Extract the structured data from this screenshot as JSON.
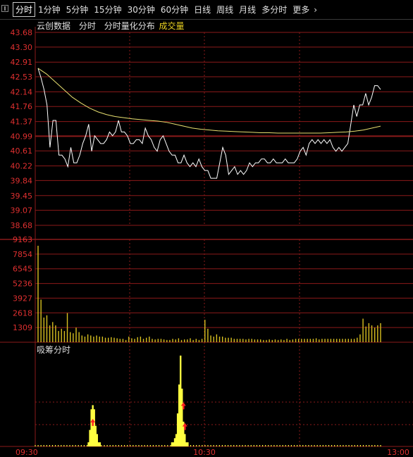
{
  "tabs": [
    {
      "label": "分时",
      "active": true
    },
    {
      "label": "1分钟"
    },
    {
      "label": "5分钟"
    },
    {
      "label": "15分钟"
    },
    {
      "label": "30分钟"
    },
    {
      "label": "60分钟"
    },
    {
      "label": "日线"
    },
    {
      "label": "周线"
    },
    {
      "label": "月线"
    },
    {
      "label": "多分时"
    },
    {
      "label": "更多"
    }
  ],
  "chart_labels": {
    "source": "云创数据",
    "mode": "分时",
    "distribution": "分时量化分布",
    "volume_label": "成交量",
    "chip_title": "吸筹分时"
  },
  "colors": {
    "background": "#000000",
    "grid": "#8b1a1a",
    "price_line": "#ffffff",
    "avg_line": "#e8e070",
    "volume_bar": "#d8c020",
    "axis_text": "#e03030",
    "chip_bar": "#ffff40",
    "chip_marker": "#ff2020"
  },
  "chart_data": [
    {
      "type": "line",
      "panel": "price",
      "yticks": [
        "43.68",
        "43.30",
        "42.91",
        "42.53",
        "42.14",
        "41.76",
        "41.37",
        "40.99",
        "40.61",
        "40.22",
        "39.84",
        "39.45",
        "39.07",
        "38.68"
      ],
      "ylim": [
        38.68,
        43.68
      ],
      "prev_close": 40.99,
      "xticks": [
        "09:30",
        "10:30",
        "13:00"
      ],
      "series": [
        {
          "values": [
            42.75,
            42.5,
            42.2,
            41.8,
            40.7,
            41.4,
            41.4,
            40.5,
            40.5,
            40.4,
            40.2,
            40.7,
            40.3,
            40.3,
            40.5,
            40.8,
            41.0,
            41.3,
            40.6,
            41.0,
            40.9,
            40.8,
            40.8,
            40.9,
            41.1,
            41.0,
            41.1,
            41.4,
            41.1,
            41.1,
            41.0,
            40.8,
            40.8,
            40.9,
            40.9,
            40.8,
            41.2,
            41.0,
            40.9,
            40.7,
            40.6,
            40.9,
            41.0,
            40.8,
            40.6,
            40.5,
            40.5,
            40.3,
            40.3,
            40.5,
            40.3,
            40.2,
            40.3,
            40.2,
            40.4,
            40.2,
            40.1,
            40.1,
            39.9,
            39.9,
            39.9,
            40.3,
            40.7,
            40.5,
            40.0,
            40.1,
            40.2,
            40.0,
            40.1,
            40.0,
            40.1,
            40.3,
            40.2,
            40.3,
            40.3,
            40.4,
            40.4,
            40.3,
            40.3,
            40.4,
            40.3,
            40.3,
            40.3,
            40.4,
            40.3,
            40.3,
            40.3,
            40.4,
            40.6,
            40.7,
            40.5,
            40.8,
            40.9,
            40.8,
            40.9,
            40.8,
            40.9,
            40.8,
            40.9,
            40.7,
            40.6,
            40.7,
            40.6,
            40.7,
            40.8,
            41.3,
            41.8,
            41.5,
            41.8,
            41.8,
            42.1,
            41.8,
            42.0,
            42.3,
            42.3,
            42.2
          ]
        },
        {
          "values": [
            42.75,
            42.6,
            42.4,
            42.2,
            42.0,
            41.85,
            41.72,
            41.62,
            41.55,
            41.5,
            41.47,
            41.44,
            41.42,
            41.4,
            41.38,
            41.35,
            41.3,
            41.25,
            41.2,
            41.17,
            41.15,
            41.13,
            41.12,
            41.11,
            41.1,
            41.09,
            41.08,
            41.08,
            41.07,
            41.07,
            41.07,
            41.07,
            41.07,
            41.07,
            41.08,
            41.09,
            41.1,
            41.12,
            41.15,
            41.2,
            41.25
          ]
        }
      ]
    },
    {
      "type": "bar",
      "panel": "volume",
      "yticks": [
        "9163",
        "7854",
        "6545",
        "5236",
        "3927",
        "2618",
        "1309"
      ],
      "ylim": [
        0,
        9163
      ],
      "series": [
        {
          "values": [
            8600,
            3800,
            2200,
            2400,
            1500,
            1800,
            1500,
            1000,
            1200,
            1000,
            2600,
            900,
            800,
            1300,
            900,
            600,
            500,
            700,
            600,
            500,
            600,
            500,
            500,
            400,
            400,
            450,
            400,
            350,
            300,
            300,
            200,
            500,
            350,
            300,
            450,
            500,
            300,
            400,
            500,
            300,
            250,
            300,
            300,
            250,
            200,
            200,
            300,
            250,
            350,
            200,
            250,
            250,
            350,
            200,
            300,
            200,
            300,
            2000,
            1200,
            600,
            500,
            700,
            500,
            500,
            400,
            400,
            400,
            300,
            300,
            300,
            300,
            250,
            300,
            300,
            250,
            250,
            250,
            200,
            200,
            250,
            200,
            250,
            200,
            250,
            200,
            300,
            200,
            250,
            300,
            300,
            300,
            300,
            300,
            300,
            300,
            350,
            250,
            300,
            300,
            300,
            300,
            300,
            300,
            300,
            300,
            300,
            300,
            300,
            300,
            400,
            700,
            2100,
            1400,
            1700,
            1500,
            1300,
            1500,
            1700
          ]
        }
      ]
    },
    {
      "type": "bar",
      "panel": "chip",
      "series": [
        {
          "values": [
            0,
            0,
            0,
            0,
            0,
            0,
            0,
            0,
            0,
            0,
            0,
            0,
            0,
            0,
            0,
            0,
            0,
            0,
            0,
            0,
            0,
            0,
            0,
            0,
            0,
            0,
            0,
            0,
            0,
            0,
            0,
            0,
            0,
            0,
            0,
            0,
            0,
            1,
            4,
            9,
            10,
            9,
            5,
            3,
            1,
            1,
            0,
            0,
            0,
            0,
            0,
            0,
            0,
            0,
            0,
            0,
            0,
            0,
            0,
            0,
            0,
            0,
            0,
            0,
            0,
            0,
            0,
            0,
            0,
            0,
            0,
            0,
            0,
            0,
            0,
            0,
            0,
            0,
            0,
            0,
            0,
            0,
            0,
            0,
            0,
            0,
            0,
            0,
            0,
            0,
            0,
            0,
            0,
            0,
            0,
            1,
            1,
            2,
            3,
            8,
            15,
            22,
            14,
            6,
            3,
            1,
            1,
            0,
            0,
            0,
            0,
            0,
            0,
            0,
            0,
            0,
            0,
            0,
            0,
            0,
            0,
            0,
            0,
            0,
            0,
            0,
            0,
            0,
            0,
            0,
            0,
            0,
            0,
            0,
            0,
            0,
            0,
            0,
            0,
            0,
            0,
            0,
            0,
            0,
            0,
            0,
            0,
            0,
            0,
            0,
            0,
            0,
            0,
            0,
            0,
            0,
            0,
            0,
            0,
            0,
            0,
            0,
            0,
            0,
            0,
            0,
            0,
            0,
            0,
            0,
            0,
            0,
            0,
            0,
            0,
            0,
            0,
            0,
            0,
            0,
            0,
            0,
            0,
            0,
            0,
            0,
            0,
            0,
            0,
            0,
            0,
            0,
            0,
            0,
            0,
            0,
            0,
            0,
            0,
            0,
            0,
            0,
            0,
            0,
            0,
            0,
            0,
            0,
            0,
            0,
            0,
            0,
            0,
            0,
            0,
            0,
            0,
            0,
            0,
            0,
            0,
            0,
            0,
            0,
            0,
            0,
            0,
            0,
            0,
            0,
            0,
            0,
            0,
            0,
            0,
            0,
            0,
            0,
            0,
            0,
            0
          ]
        }
      ],
      "markers": [
        {
          "index": 40,
          "value": 6
        },
        {
          "index": 103,
          "value": 10
        },
        {
          "index": 104,
          "value": 5
        }
      ]
    }
  ]
}
